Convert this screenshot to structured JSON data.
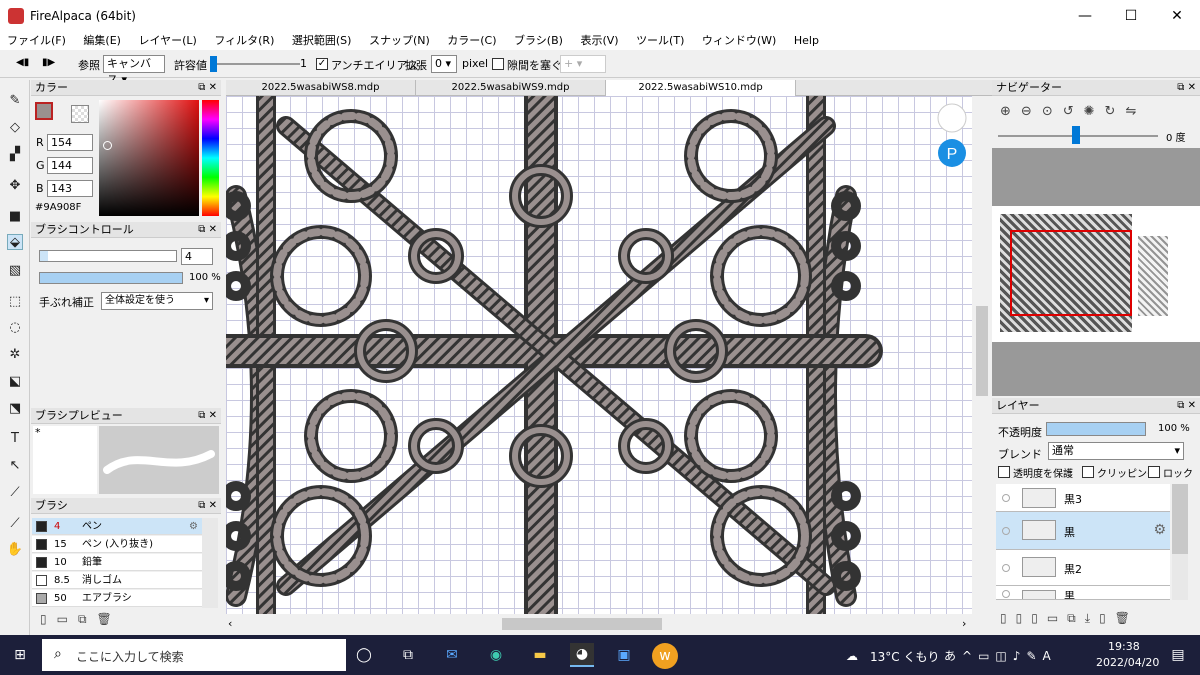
{
  "window": {
    "title": "FireAlpaca (64bit)",
    "minimize": "—",
    "maximize": "☐",
    "close": "✕"
  },
  "menu": [
    "ファイル(F)",
    "編集(E)",
    "レイヤー(L)",
    "フィルタ(R)",
    "選択範囲(S)",
    "スナップ(N)",
    "カラー(C)",
    "ブラシ(B)",
    "表示(V)",
    "ツール(T)",
    "ウィンドウ(W)",
    "Help"
  ],
  "toolbar": {
    "ref_label": "参照",
    "ref_value": "キャンバス",
    "tolerance_label": "許容値",
    "tolerance_value": "1",
    "antialias_label": "アンチエイリアス",
    "antialias_checked": true,
    "expand_label": "拡張",
    "expand_value": "0",
    "pixel_label": "pixel",
    "gap_label": "隙間を塞ぐ",
    "gap_checked": false,
    "gap_value": "+"
  },
  "tabs": [
    "2022.5wasabiWS8.mdp",
    "2022.5wasabiWS9.mdp",
    "2022.5wasabiWS10.mdp"
  ],
  "color_panel": {
    "title": "カラー",
    "r_label": "R",
    "r": "154",
    "g_label": "G",
    "g": "144",
    "b_label": "B",
    "b": "143",
    "hex": "#9A908F",
    "current_color": "#9A908F"
  },
  "brush_control": {
    "title": "ブラシコントロール",
    "size": "4",
    "opacity": "100 %",
    "opacity_fraction": 1.0,
    "stabilizer_label": "手ぶれ補正",
    "stabilizer_value": "全体設定を使う"
  },
  "brush_preview": {
    "title": "ブラシプレビュー",
    "marker": "*"
  },
  "brush_list": {
    "title": "ブラシ",
    "items": [
      {
        "size": "4",
        "name": "ペン",
        "selected": true
      },
      {
        "size": "15",
        "name": "ペン (入り抜き)",
        "selected": false
      },
      {
        "size": "10",
        "name": "鉛筆",
        "selected": false
      },
      {
        "size": "8.5",
        "name": "消しゴム",
        "selected": false
      },
      {
        "size": "50",
        "name": "エアブラシ",
        "selected": false
      }
    ]
  },
  "navigator": {
    "title": "ナビゲーター",
    "rotation": "0 度"
  },
  "layers": {
    "title": "レイヤー",
    "opacity_label": "不透明度",
    "opacity_value": "100 %",
    "opacity_fraction": 1.0,
    "blend_label": "ブレンド",
    "blend_value": "通常",
    "protect_alpha": "透明度を保護",
    "clipping": "クリッピング",
    "lock": "ロック",
    "items": [
      {
        "name": "黒3",
        "selected": false
      },
      {
        "name": "黒",
        "selected": true
      },
      {
        "name": "黒2",
        "selected": false
      },
      {
        "name": "黒",
        "selected": false
      }
    ]
  },
  "taskbar": {
    "search_placeholder": "ここに入力して検索",
    "weather": "13°C くもり",
    "time": "19:38",
    "date": "2022/04/20"
  },
  "colors": {
    "selection": "#cce4f7",
    "accent": "#0078d7",
    "taskbar": "#1c1f3a"
  }
}
